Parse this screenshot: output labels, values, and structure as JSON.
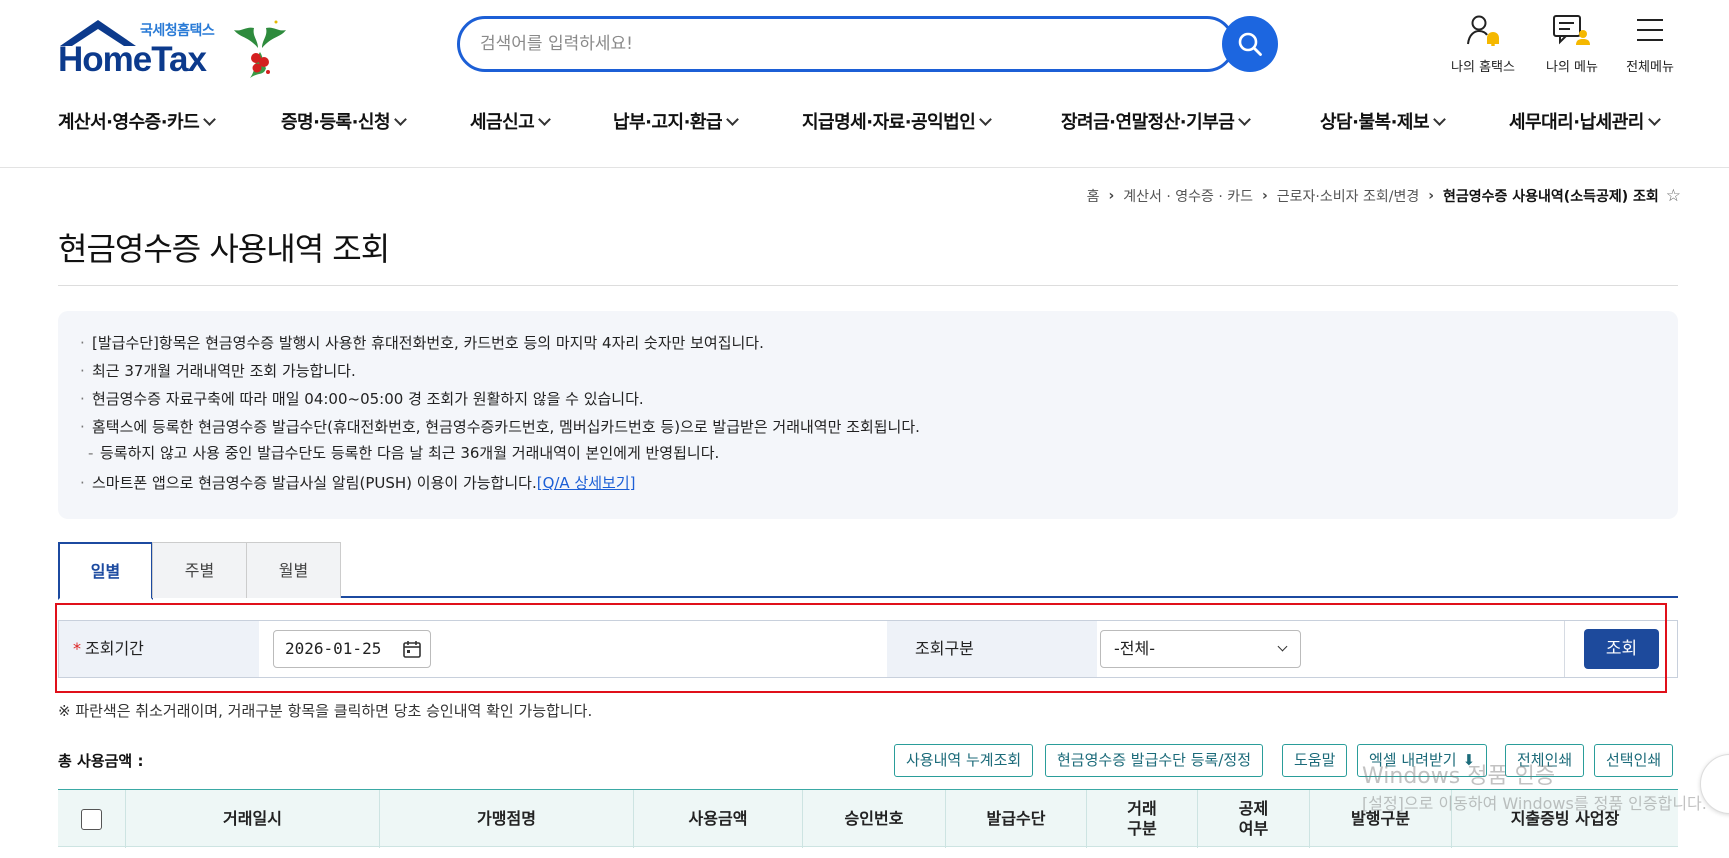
{
  "logo": {
    "sub": "국세청홈택스",
    "main": "HomeTax"
  },
  "search": {
    "placeholder": "검색어를 입력하세요!"
  },
  "top_icons": [
    {
      "label": "나의 홈택스",
      "icon": "person-bell-icon"
    },
    {
      "label": "나의 메뉴",
      "icon": "my-menu-icon"
    },
    {
      "label": "전체메뉴",
      "icon": "hamburger-icon"
    }
  ],
  "gnb": [
    "계산서·영수증·카드",
    "증명·등록·신청",
    "세금신고",
    "납부·고지·환급",
    "지급명세·자료·공익법인",
    "장려금·연말정산·기부금",
    "상담·불복·제보",
    "세무대리·납세관리"
  ],
  "breadcrumb": {
    "items": [
      "홈",
      "계산서 · 영수증 · 카드",
      "근로자·소비자 조회/변경"
    ],
    "current": "현금영수증 사용내역(소득공제) 조회"
  },
  "page_title": "현금영수증 사용내역 조회",
  "notice": {
    "items": [
      "[발급수단]항목은 현금영수증 발행시 사용한 휴대전화번호, 카드번호 등의 마지막 4자리 숫자만 보여집니다.",
      "최근 37개월 거래내역만 조회 가능합니다.",
      "현금영수증 자료구축에 따라 매일 04:00~05:00 경 조회가 원활하지 않을 수 있습니다.",
      "홈택스에 등록한 현금영수증 발급수단(휴대전화번호, 현금영수증카드번호, 멤버십카드번호 등)으로 발급받은 거래내역만 조회됩니다."
    ],
    "dash_item": "등록하지 않고 사용 중인 발급수단도 등록한 다음 날 최근 36개월 거래내역이 본인에게 반영됩니다.",
    "push_item": "스마트폰 앱으로 현금영수증 발급사실 알림(PUSH) 이용이 가능합니다.",
    "push_link": "[Q/A 상세보기]"
  },
  "tabs": [
    "일별",
    "주별",
    "월별"
  ],
  "form": {
    "period_label": "조회기간",
    "required_mark": "*",
    "date_value": "2026-01-25",
    "type_label": "조회구분",
    "type_value": "-전체-",
    "submit": "조회"
  },
  "hint": "※ 파란색은 취소거래이며, 거래구분 항목을 클릭하면 당초 승인내역 확인 가능합니다.",
  "total_label": "총 사용금액 :",
  "actions": [
    "사용내역 누계조회",
    "현금영수증 발급수단 등록/정정",
    "도움말",
    "엑셀 내려받기",
    "전체인쇄",
    "선택인쇄"
  ],
  "table": {
    "headers": [
      "거래일시",
      "가맹점명",
      "사용금액",
      "승인번호",
      "발급수단",
      "거래\n구분",
      "공제\n여부",
      "발행구분",
      "지출증빙 사업장"
    ]
  },
  "watermark": {
    "line1": "Windows 정품 인증",
    "line2": "[설정]으로 이동하여 Windows를 정품 인증합니다."
  },
  "colors": {
    "brand_blue": "#1c5fd6",
    "navy": "#1d4a9c",
    "teal": "#2a9d9a",
    "highlight_red": "#e0101a"
  }
}
